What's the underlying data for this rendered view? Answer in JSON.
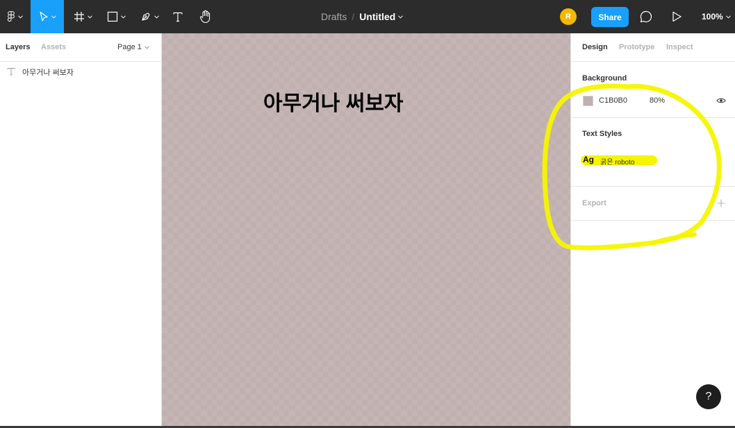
{
  "toolbar": {
    "main_menu_icon": "figma-logo-icon",
    "tools": [
      "move-tool",
      "frame-tool",
      "shape-tool",
      "pen-tool",
      "text-tool",
      "hand-tool"
    ],
    "breadcrumb_parent": "Drafts",
    "breadcrumb_separator": "/",
    "file_name": "Untitled",
    "avatar_initial": "R",
    "share_label": "Share",
    "zoom_label": "100%",
    "accent_color": "#18a0fb"
  },
  "left_panel": {
    "tabs": [
      "Layers",
      "Assets"
    ],
    "page_label": "Page 1",
    "layers": [
      {
        "icon": "text-layer-icon",
        "name": "아무거나 써보자"
      }
    ]
  },
  "canvas": {
    "background_color": "#c1b0b0",
    "text": "아무거나 써보자"
  },
  "right_panel": {
    "tabs": [
      "Design",
      "Prototype",
      "Inspect"
    ],
    "background": {
      "title": "Background",
      "hex": "C1B0B0",
      "opacity": "80%"
    },
    "text_styles": {
      "title": "Text Styles",
      "sample": "Ag",
      "style_name": "굵은 roboto"
    },
    "export": {
      "title": "Export"
    }
  },
  "help_label": "?",
  "annotation_color": "#f5f500"
}
